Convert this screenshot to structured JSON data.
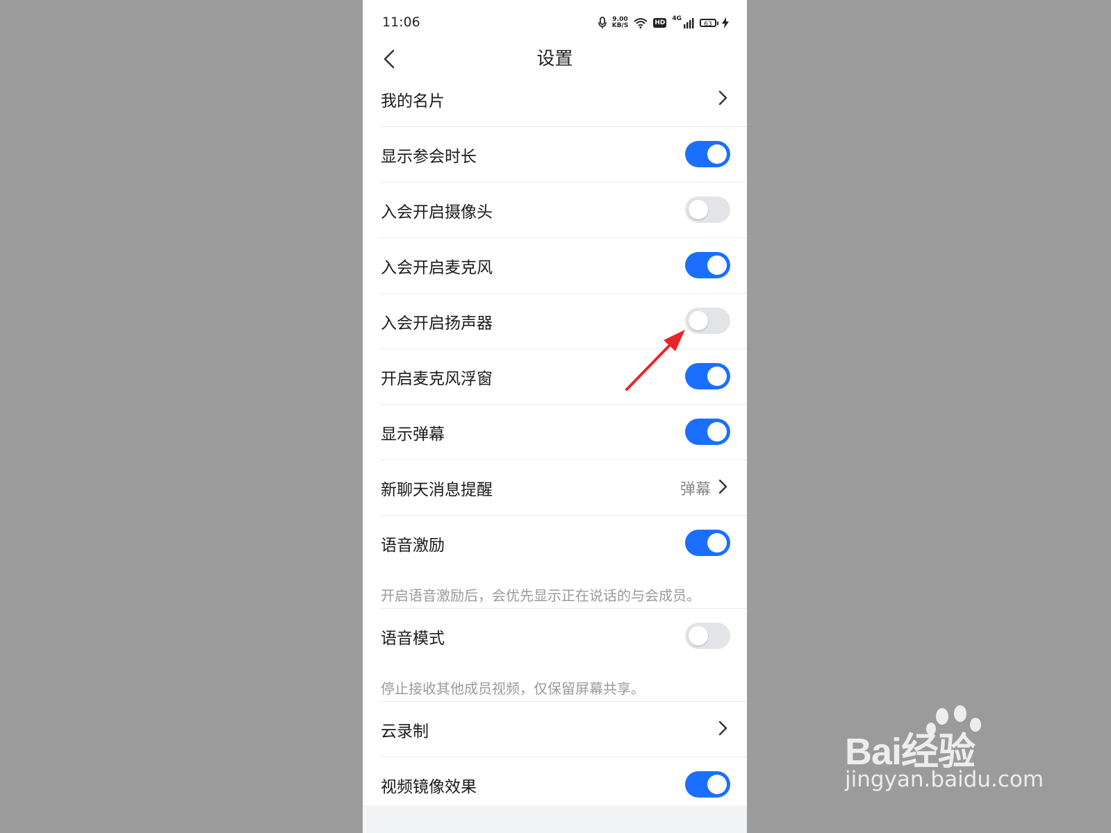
{
  "status_bar": {
    "time": "11:06",
    "net_speed_value": "9.00",
    "net_speed_unit": "KB/S",
    "hd": "HD",
    "signal_label": "4G",
    "battery": "63"
  },
  "header": {
    "title": "设置"
  },
  "settings": [
    {
      "label": "我的名片",
      "control": "chevron"
    },
    {
      "label": "显示参会时长",
      "control": "toggle",
      "on": true
    },
    {
      "label": "入会开启摄像头",
      "control": "toggle",
      "on": false
    },
    {
      "label": "入会开启麦克风",
      "control": "toggle",
      "on": true
    },
    {
      "label": "入会开启扬声器",
      "control": "toggle",
      "on": false
    },
    {
      "label": "开启麦克风浮窗",
      "control": "toggle",
      "on": true
    },
    {
      "label": "显示弹幕",
      "control": "toggle",
      "on": true
    },
    {
      "label": "新聊天消息提醒",
      "control": "chevron",
      "value": "弹幕"
    },
    {
      "label": "语音激励",
      "control": "toggle",
      "on": true,
      "description": "开启语音激励后，会优先显示正在说话的与会成员。"
    },
    {
      "label": "语音模式",
      "control": "toggle",
      "on": false,
      "description": "停止接收其他成员视频，仅保留屏幕共享。"
    },
    {
      "label": "云录制",
      "control": "chevron"
    },
    {
      "label": "视频镜像效果",
      "control": "toggle",
      "on": true
    }
  ],
  "watermark": {
    "brand": "Bai经验",
    "url": "jingyan.baidu.com"
  },
  "colors": {
    "toggle_on": "#1a6fff",
    "toggle_off": "#e3e4e7",
    "annotation_arrow": "#e8262a"
  }
}
